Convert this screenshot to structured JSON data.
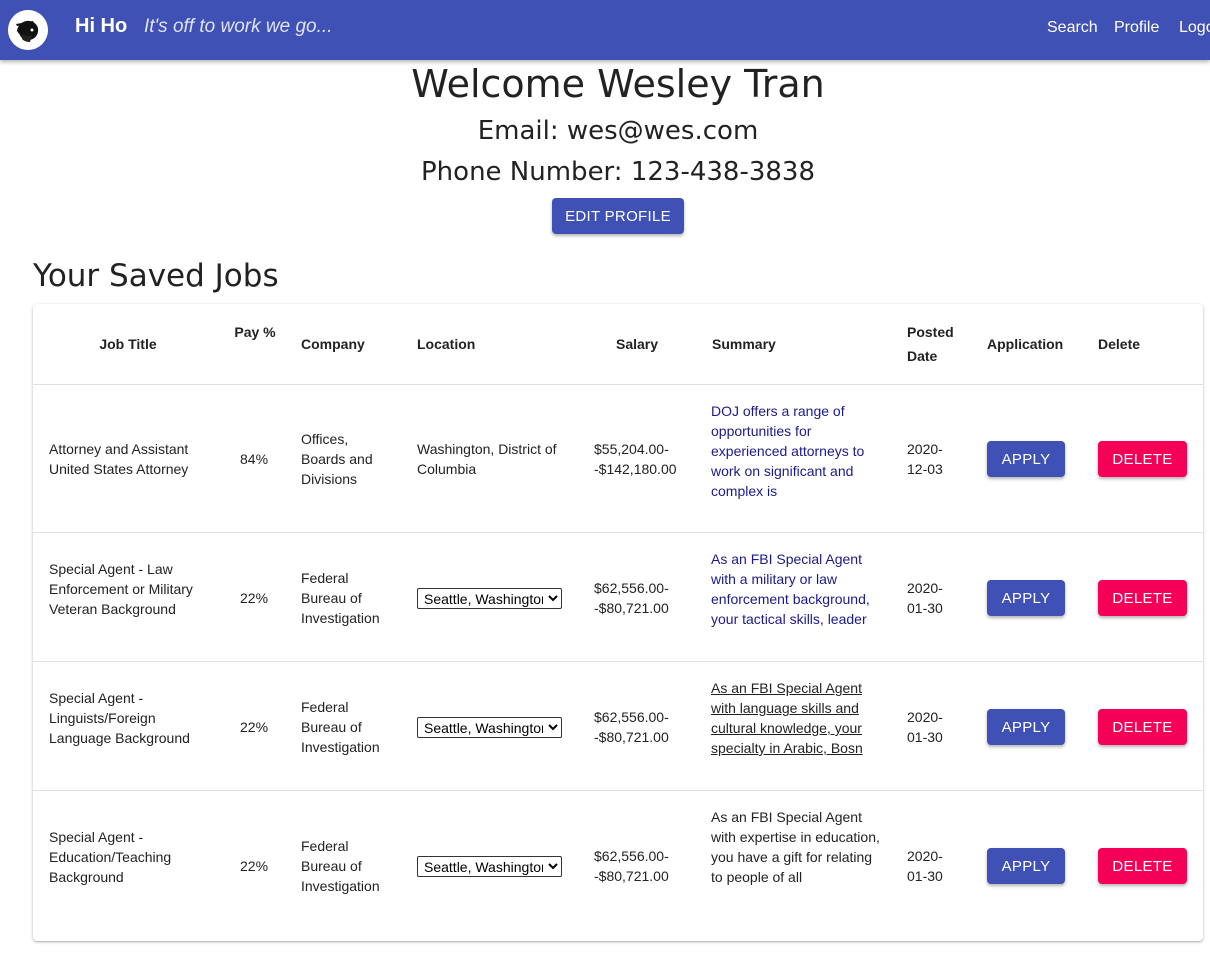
{
  "app": {
    "brand": "Hi Ho",
    "tagline": "It's off to work we go...",
    "nav": [
      "Search",
      "Profile",
      "Logout"
    ]
  },
  "profile": {
    "welcome": "Welcome Wesley Tran",
    "email": "Email: wes@wes.com",
    "phone": "Phone Number: 123-438-3838",
    "edit_label": "EDIT PROFILE"
  },
  "saved_jobs": {
    "title": "Your Saved Jobs",
    "headers": {
      "job_title": "Job Title",
      "pay": "Pay %",
      "company": "Company",
      "location": "Location",
      "salary": "Salary",
      "summary": "Summary",
      "posted": "Posted Date",
      "application": "Application",
      "delete": "Delete"
    },
    "rows": [
      {
        "job_title": "Attorney and Assistant United States Attorney",
        "pay": "84%",
        "company": "Offices, Boards and Divisions",
        "location": "Washington, District of Columbia",
        "salary": "$55,204.00--$142,180.00",
        "summary": "DOJ offers a range of opportunities for experienced attorneys to work on significant and complex is",
        "posted": "2020-12-03",
        "apply_label": "APPLY",
        "delete_label": "DELETE"
      },
      {
        "job_title": "Special Agent - Law Enforcement or Military Veteran Background",
        "pay": "22%",
        "company": "Federal Bureau of Investigation",
        "location_select": "Seattle, Washington",
        "salary": "$62,556.00--$80,721.00",
        "summary": "As an FBI Special Agent with a military or law enforcement background, your tactical skills, leader",
        "posted": "2020-01-30",
        "apply_label": "APPLY",
        "delete_label": "DELETE"
      },
      {
        "job_title": "Special Agent - Linguists/Foreign Language Background",
        "pay": "22%",
        "company": "Federal Bureau of Investigation",
        "location_select": "Seattle, Washington",
        "salary": "$62,556.00--$80,721.00",
        "summary": "As an FBI Special Agent with language skills and cultural knowledge, your specialty in Arabic, Bosn",
        "posted": "2020-01-30",
        "apply_label": "APPLY",
        "delete_label": "DELETE"
      },
      {
        "job_title": "Special Agent - Education/Teaching Background",
        "pay": "22%",
        "company": "Federal Bureau of Investigation",
        "location_select": "Seattle, Washington",
        "salary": "$62,556.00--$80,721.00",
        "summary": "As an FBI Special Agent with expertise in education, you have a gift for relating to people of all",
        "posted": "2020-01-30",
        "apply_label": "APPLY",
        "delete_label": "DELETE"
      }
    ]
  },
  "colors": {
    "primary": "#3f51b5",
    "secondary": "#f50057",
    "summary_link": "#1a1a8c"
  },
  "icons": {
    "logo": "dwarf-miner-logo-icon",
    "select_arrow": "chevron-down-icon"
  }
}
